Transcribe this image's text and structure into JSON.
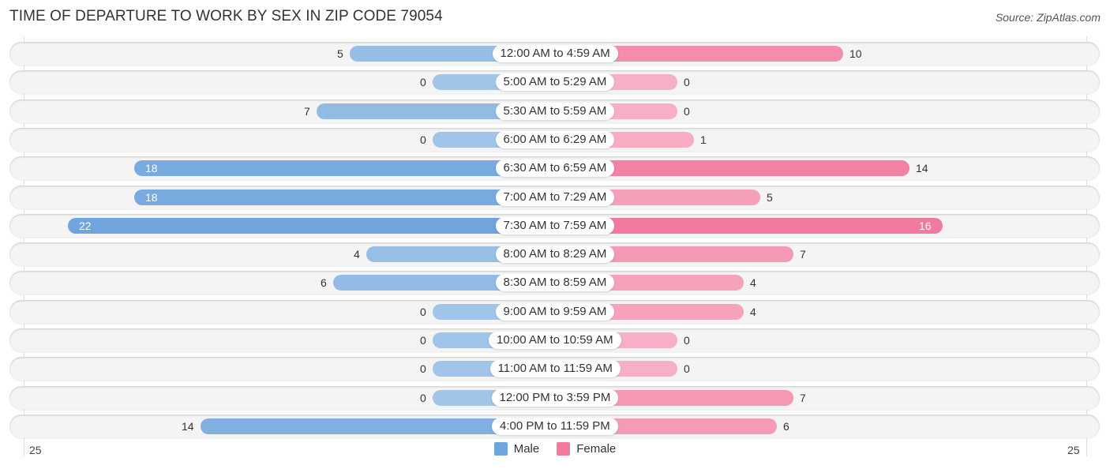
{
  "title": "TIME OF DEPARTURE TO WORK BY SEX IN ZIP CODE 79054",
  "source": "Source: ZipAtlas.com",
  "chart_data": {
    "type": "bar",
    "orientation": "horizontal-diverging",
    "title": "TIME OF DEPARTURE TO WORK BY SEX IN ZIP CODE 79054",
    "categories": [
      "12:00 AM to 4:59 AM",
      "5:00 AM to 5:29 AM",
      "5:30 AM to 5:59 AM",
      "6:00 AM to 6:29 AM",
      "6:30 AM to 6:59 AM",
      "7:00 AM to 7:29 AM",
      "7:30 AM to 7:59 AM",
      "8:00 AM to 8:29 AM",
      "8:30 AM to 8:59 AM",
      "9:00 AM to 9:59 AM",
      "10:00 AM to 10:59 AM",
      "11:00 AM to 11:59 AM",
      "12:00 PM to 3:59 PM",
      "4:00 PM to 11:59 PM"
    ],
    "series": [
      {
        "name": "Male",
        "color": "#6fa4dd",
        "values": [
          5,
          0,
          7,
          0,
          18,
          18,
          22,
          4,
          6,
          0,
          0,
          0,
          0,
          14
        ]
      },
      {
        "name": "Female",
        "color": "#f27a9e",
        "values": [
          10,
          0,
          0,
          1,
          14,
          5,
          16,
          7,
          4,
          4,
          0,
          0,
          7,
          6
        ]
      }
    ],
    "axis": {
      "left_tick": "25",
      "right_tick": "25",
      "xlim": [
        -25,
        25
      ]
    },
    "legend": {
      "position": "bottom-center",
      "entries": [
        "Male",
        "Female"
      ]
    }
  }
}
